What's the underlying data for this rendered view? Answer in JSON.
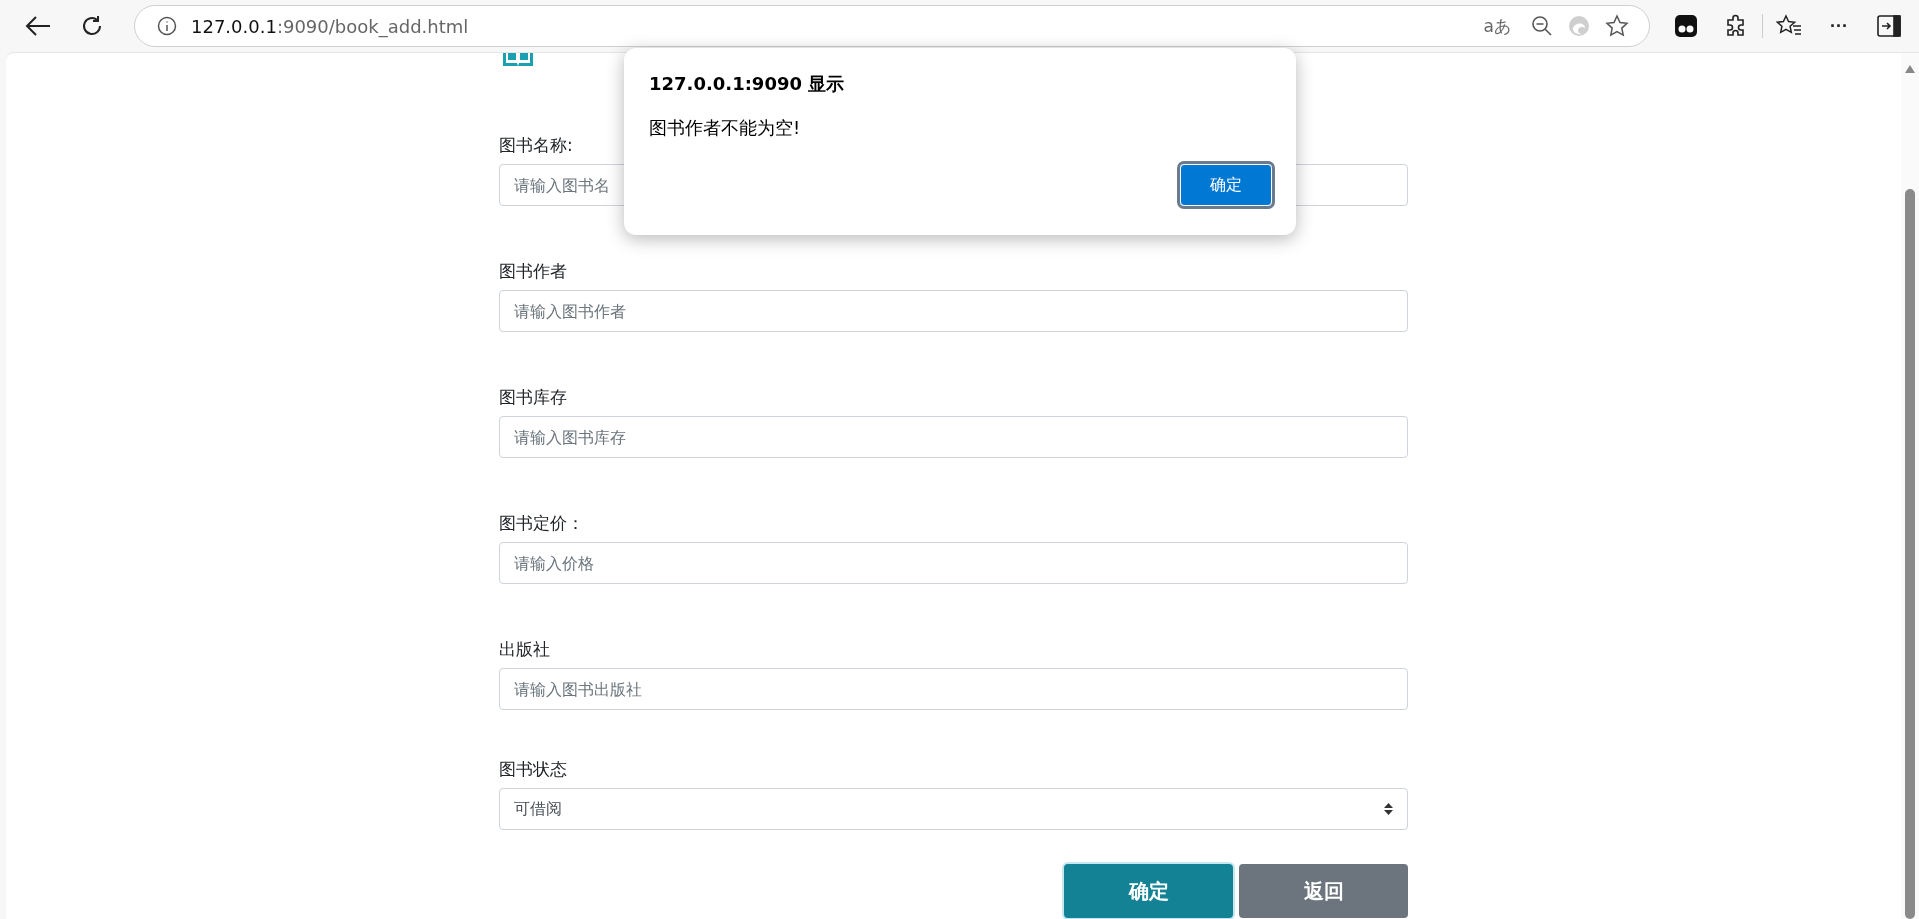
{
  "browser": {
    "url_host": "127.0.0.1",
    "url_rest": ":9090/book_add.html",
    "read_aloud": "aあ",
    "more": "···"
  },
  "form": {
    "fields": [
      {
        "kind": "input",
        "label": "图书名称:",
        "placeholder": "请输入图书名"
      },
      {
        "kind": "input",
        "label": "图书作者",
        "placeholder": "请输入图书作者"
      },
      {
        "kind": "input",
        "label": "图书库存",
        "placeholder": "请输入图书库存"
      },
      {
        "kind": "input",
        "label": "图书定价：",
        "placeholder": "请输入价格"
      },
      {
        "kind": "input",
        "label": "出版社",
        "placeholder": "请输入图书出版社"
      },
      {
        "kind": "select",
        "label": "图书状态",
        "value": "可借阅"
      }
    ],
    "buttons": [
      {
        "label": "确定",
        "kind": "primary"
      },
      {
        "label": "返回",
        "kind": "secondary"
      }
    ]
  },
  "dialog": {
    "title": "127.0.0.1:9090 显示",
    "message": "图书作者不能为空!",
    "button": "确定"
  }
}
